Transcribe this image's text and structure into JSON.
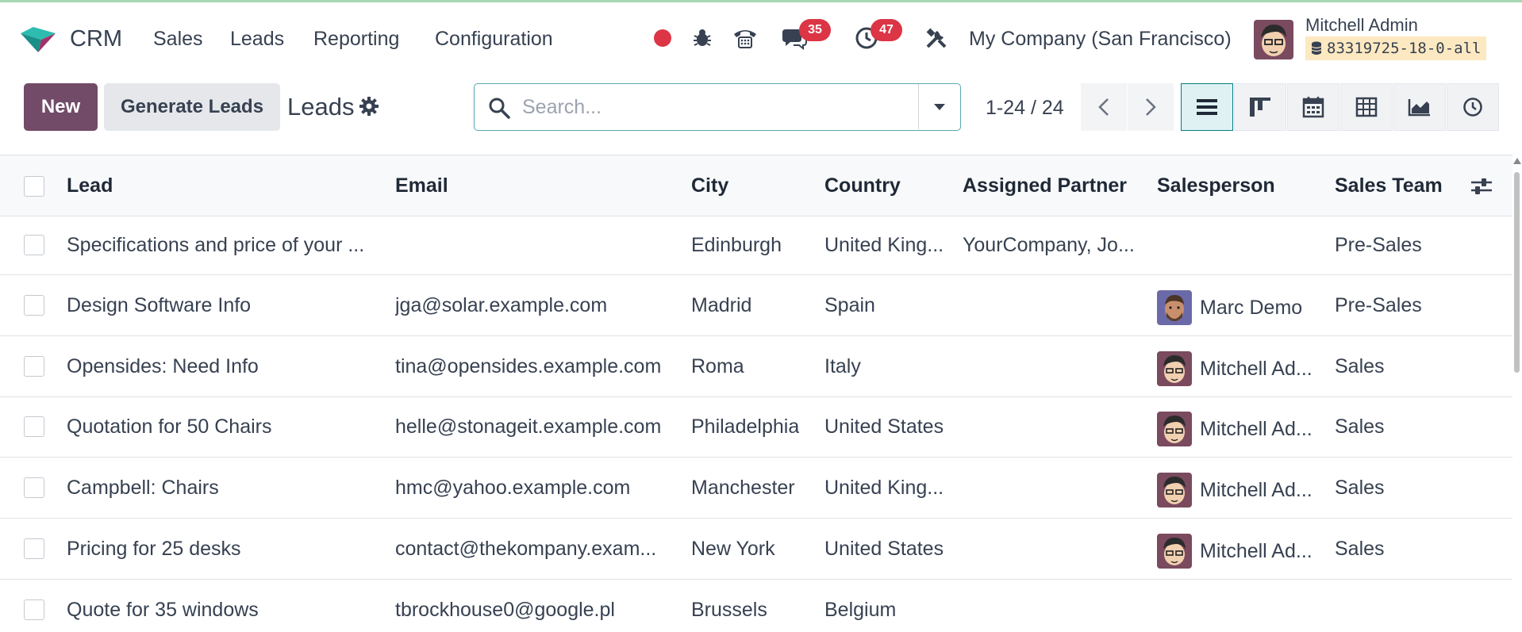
{
  "app": {
    "name": "CRM"
  },
  "nav": {
    "menus": [
      "Sales",
      "Leads",
      "Reporting",
      "Configuration"
    ],
    "messages_count": "35",
    "activities_count": "47",
    "company": "My Company (San Francisco)",
    "user_name": "Mitchell Admin",
    "database": "83319725-18-0-all"
  },
  "control_panel": {
    "new_label": "New",
    "generate_label": "Generate Leads",
    "view_title": "Leads",
    "search_placeholder": "Search...",
    "pager": "1-24 / 24",
    "views": [
      "list-icon",
      "kanban-icon",
      "calendar-icon",
      "pivot-icon",
      "graph-icon",
      "activity-icon"
    ],
    "active_view": "list-icon"
  },
  "table": {
    "columns": [
      "Lead",
      "Email",
      "City",
      "Country",
      "Assigned Partner",
      "Salesperson",
      "Sales Team"
    ],
    "rows": [
      {
        "lead": "Specifications and price of your ...",
        "email": "",
        "city": "Edinburgh",
        "country": "United King...",
        "partner": "YourCompany, Jo...",
        "salesperson": "",
        "avatar": "",
        "team": "Pre-Sales"
      },
      {
        "lead": "Design Software Info",
        "email": "jga@solar.example.com",
        "city": "Madrid",
        "country": "Spain",
        "partner": "",
        "salesperson": "Marc Demo",
        "avatar": "marc",
        "team": "Pre-Sales"
      },
      {
        "lead": "Opensides: Need Info",
        "email": "tina@opensides.example.com",
        "city": "Roma",
        "country": "Italy",
        "partner": "",
        "salesperson": "Mitchell Ad...",
        "avatar": "mitchell",
        "team": "Sales"
      },
      {
        "lead": "Quotation for 50 Chairs",
        "email": "helle@stonageit.example.com",
        "city": "Philadelphia",
        "country": "United States",
        "partner": "",
        "salesperson": "Mitchell Ad...",
        "avatar": "mitchell",
        "team": "Sales"
      },
      {
        "lead": "Campbell: Chairs",
        "email": "hmc@yahoo.example.com",
        "city": "Manchester",
        "country": "United King...",
        "partner": "",
        "salesperson": "Mitchell Ad...",
        "avatar": "mitchell",
        "team": "Sales"
      },
      {
        "lead": "Pricing for 25 desks",
        "email": "contact@thekompany.exam...",
        "city": "New York",
        "country": "United States",
        "partner": "",
        "salesperson": "Mitchell Ad...",
        "avatar": "mitchell",
        "team": "Sales"
      },
      {
        "lead": "Quote for 35 windows",
        "email": "tbrockhouse0@google.pl",
        "city": "Brussels",
        "country": "Belgium",
        "partner": "",
        "salesperson": "",
        "avatar": "",
        "team": ""
      }
    ]
  },
  "colors": {
    "primary": "#714b67",
    "accent": "#017e84",
    "badge": "#dc3545"
  }
}
